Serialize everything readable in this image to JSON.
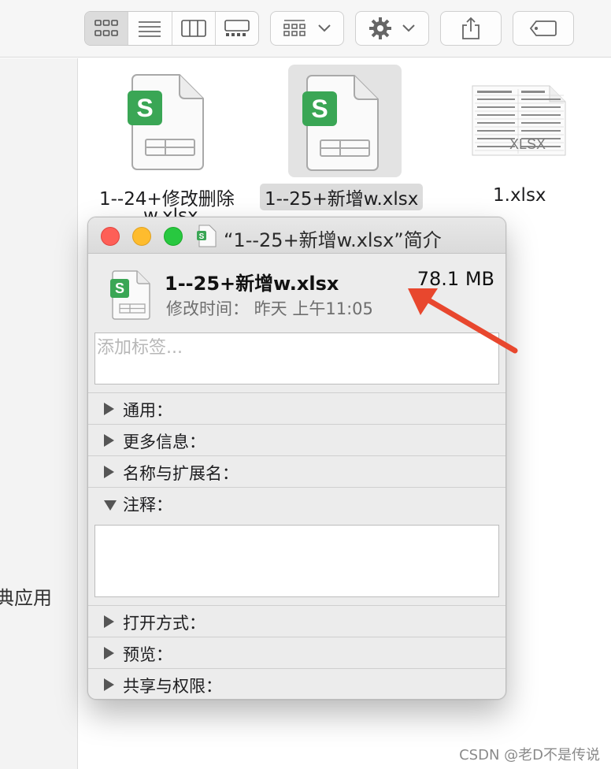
{
  "toolbar": {
    "view_modes": [
      "icons",
      "list",
      "columns",
      "gallery"
    ],
    "active_view": "icons"
  },
  "sidebar": {
    "partial_label": "典应用"
  },
  "files": [
    {
      "name_line1": "1--24+修改删除",
      "name_line2": "w.xlsx",
      "type": "xlsx-wps",
      "selected": false
    },
    {
      "name_line1": "1--25+新增w.xlsx",
      "type": "xlsx-wps",
      "selected": true
    },
    {
      "name_line1": "1.xlsx",
      "type": "xlsx-preview",
      "selected": false,
      "overlay_text": "XLSX"
    }
  ],
  "info_window": {
    "title": "“1--25+新增w.xlsx”简介",
    "file_name": "1--25+新增w.xlsx",
    "file_size": "78.1 MB",
    "modified": "修改时间： 昨天 上午11:05",
    "tags_placeholder": "添加标签...",
    "sections": [
      {
        "label": "通用：",
        "expanded": false
      },
      {
        "label": "更多信息：",
        "expanded": false
      },
      {
        "label": "名称与扩展名：",
        "expanded": false
      },
      {
        "label": "注释：",
        "expanded": true
      },
      {
        "label": "打开方式：",
        "expanded": false
      },
      {
        "label": "预览：",
        "expanded": false
      },
      {
        "label": "共享与权限：",
        "expanded": false
      }
    ],
    "comments_value": ""
  },
  "colors": {
    "wps_green": "#3aa655",
    "close": "#fe5f57",
    "minimize": "#febc2e",
    "zoom": "#28c840",
    "annotation_arrow": "#e8472e"
  },
  "watermark": "CSDN @老D不是传说"
}
